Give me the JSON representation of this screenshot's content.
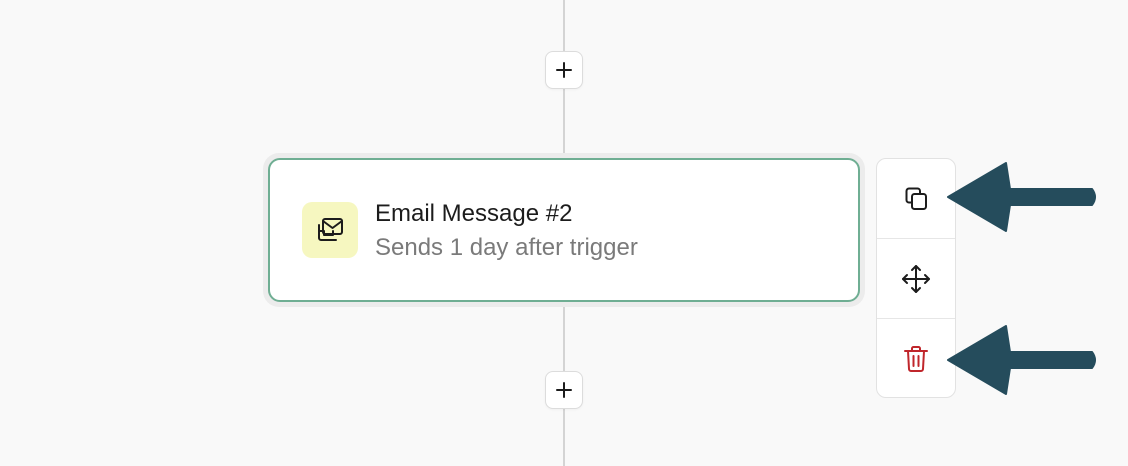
{
  "workflow": {
    "add_step_icon": "plus-icon",
    "step": {
      "title": "Email Message #2",
      "subtitle": "Sends 1 day after trigger",
      "icon": "email-stack-icon",
      "icon_bg_color": "#f6f7c0",
      "border_color": "#6fae93"
    }
  },
  "actions": {
    "duplicate_icon": "copy-icon",
    "move_icon": "move-icon",
    "delete_icon": "trash-icon",
    "delete_color": "#c0262b"
  },
  "annotations": {
    "arrow_color": "#254c5c"
  }
}
